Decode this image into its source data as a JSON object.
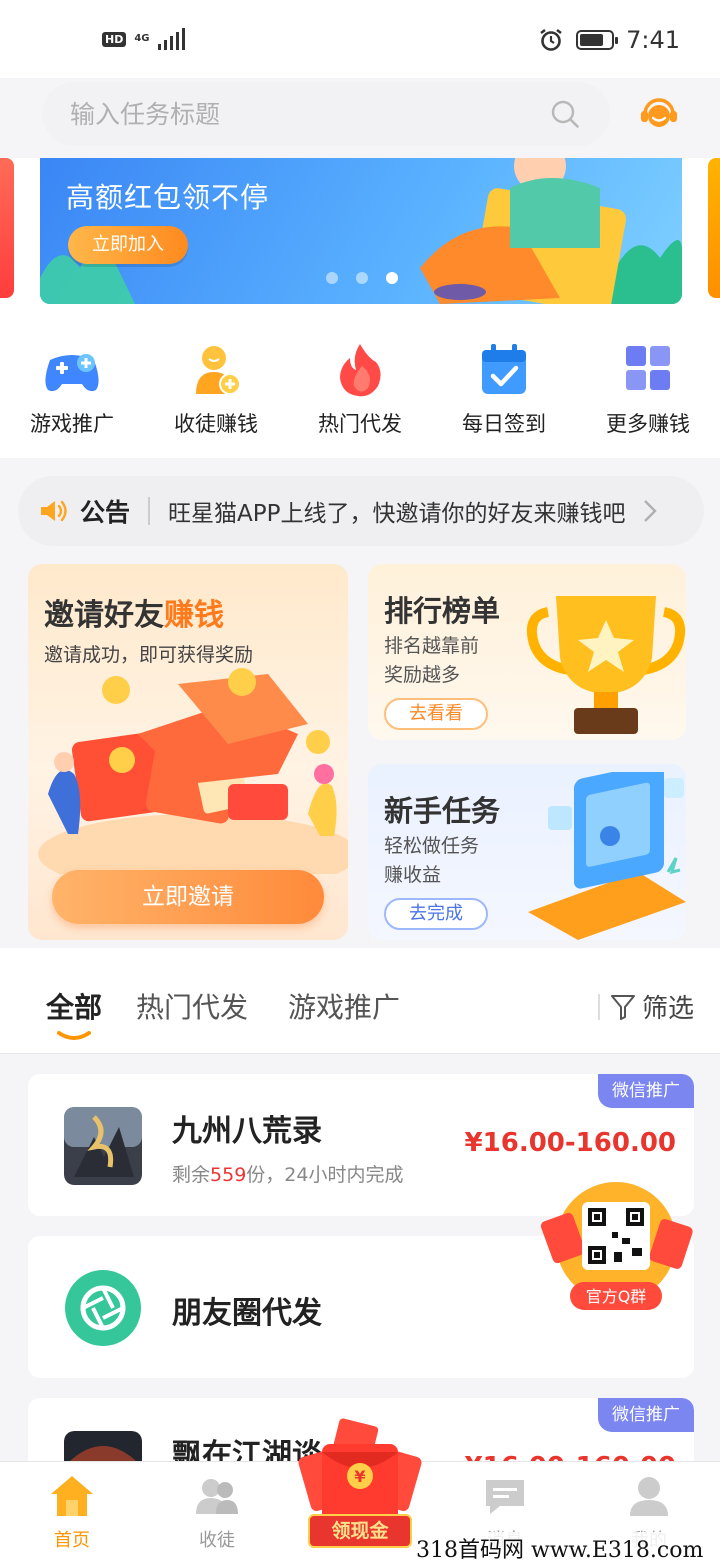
{
  "status_bar": {
    "network": "HD",
    "signal_label": "4G",
    "time": "7:41"
  },
  "search": {
    "placeholder": "输入任务标题"
  },
  "banner": {
    "title": "高额红包领不停",
    "button": "立即加入"
  },
  "quick_menu": [
    {
      "label": "游戏推广",
      "icon": "gamepad-icon"
    },
    {
      "label": "收徒赚钱",
      "icon": "recruit-user-icon"
    },
    {
      "label": "热门代发",
      "icon": "flame-icon"
    },
    {
      "label": "每日签到",
      "icon": "calendar-check-icon"
    },
    {
      "label": "更多赚钱",
      "icon": "grid-icon"
    }
  ],
  "announcement": {
    "title": "公告",
    "text": "旺星猫APP上线了，快邀请你的好友来赚钱吧"
  },
  "promo": {
    "invite": {
      "title_main": "邀请好友",
      "title_highlight": "赚钱",
      "subtitle": "邀请成功，即可获得奖励",
      "button": "立即邀请"
    },
    "rank": {
      "title": "排行榜单",
      "line1": "排名越靠前",
      "line2": "奖励越多",
      "button": "去看看"
    },
    "newbie": {
      "title": "新手任务",
      "line1": "轻松做任务",
      "line2": "赚收益",
      "button": "去完成"
    }
  },
  "tabs": {
    "items": [
      "全部",
      "热门代发",
      "游戏推广"
    ],
    "active": "全部",
    "filter": "筛选"
  },
  "tasks": [
    {
      "name": "九州八荒录",
      "tag": "微信推广",
      "remain_prefix": "剩余",
      "remain_count": "559",
      "remain_suffix": "份，24小时内完成",
      "price": "¥16.00-160.00"
    },
    {
      "name": "朋友圈代发",
      "tag": "",
      "price": ""
    },
    {
      "name": "飘在江湖谈",
      "tag": "微信推广",
      "price": "¥16.00-160.00"
    }
  ],
  "floating": {
    "qr_label": "官方Q群"
  },
  "tabbar": {
    "items": [
      {
        "label": "首页",
        "active": true
      },
      {
        "label": "收徒",
        "active": false
      },
      {
        "label": "消息",
        "active": false
      },
      {
        "label": "我的",
        "active": false
      }
    ],
    "center_label": "领现金"
  },
  "watermark": "318首码网 www.E318.com",
  "colors": {
    "accent": "#ff9500",
    "price": "#e8362f",
    "tag": "#7b86f0"
  }
}
